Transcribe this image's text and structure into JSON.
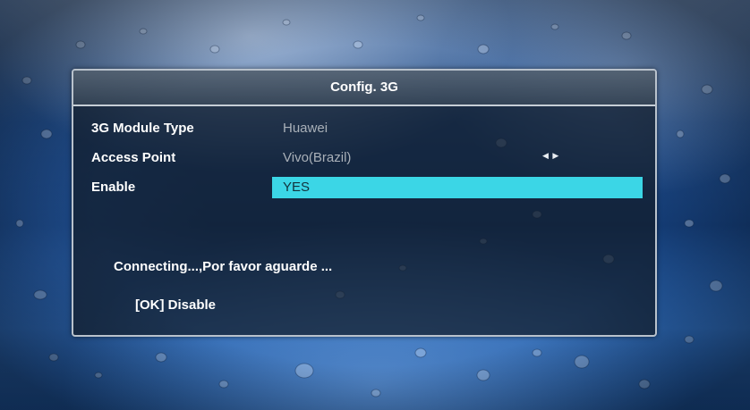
{
  "dialog": {
    "title": "Config. 3G",
    "rows": [
      {
        "label": "3G Module Type",
        "value": "Huawei"
      },
      {
        "label": "Access Point",
        "value": "Vivo(Brazil)",
        "arrows": "◀ ▶"
      },
      {
        "label": "Enable",
        "value": "YES"
      }
    ],
    "status": "Connecting...,Por favor aguarde ...",
    "hint": "[OK] Disable"
  },
  "colors": {
    "highlight": "#3bd6e6",
    "label": "#ffffff",
    "value": "#a9b0b8",
    "frame": "#b9c2cc"
  }
}
